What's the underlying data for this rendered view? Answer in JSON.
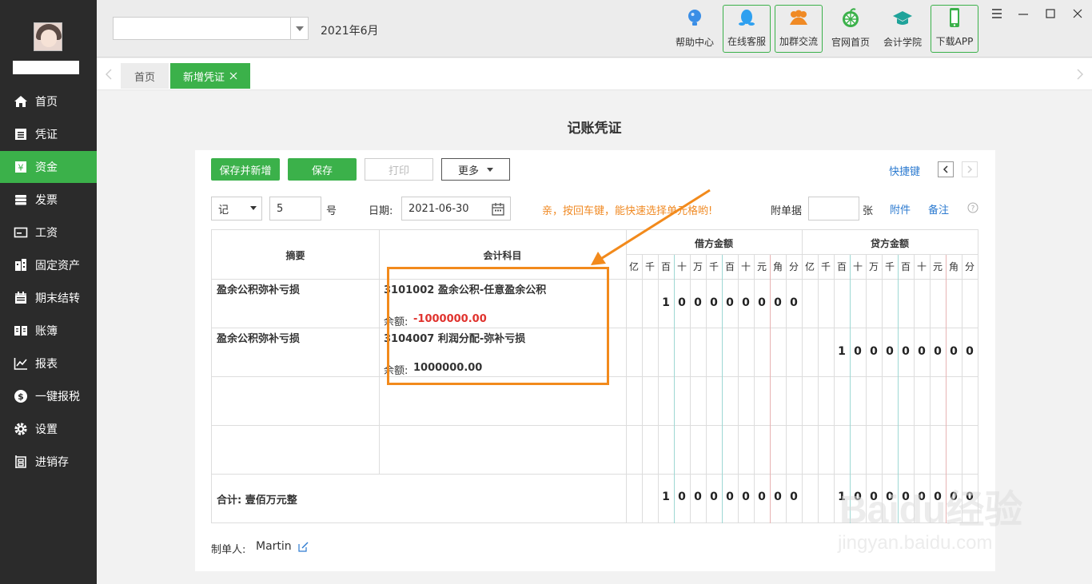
{
  "header": {
    "period": "2021年6月",
    "buttons": [
      {
        "label": "帮助中心"
      },
      {
        "label": "在线客服"
      },
      {
        "label": "加群交流"
      },
      {
        "label": "官网首页"
      },
      {
        "label": "会计学院"
      },
      {
        "label": "下载APP"
      }
    ]
  },
  "sidebar": {
    "items": [
      {
        "label": "首页"
      },
      {
        "label": "凭证"
      },
      {
        "label": "资金"
      },
      {
        "label": "发票"
      },
      {
        "label": "工资"
      },
      {
        "label": "固定资产"
      },
      {
        "label": "期末结转"
      },
      {
        "label": "账簿"
      },
      {
        "label": "报表"
      },
      {
        "label": "一键报税"
      },
      {
        "label": "设置"
      },
      {
        "label": "进销存"
      }
    ],
    "active": "资金"
  },
  "tabs": [
    {
      "label": "首页"
    },
    {
      "label": "新增凭证"
    }
  ],
  "page": {
    "title": "记账凭证",
    "save_new_label": "保存并新增",
    "save_label": "保存",
    "print_label": "打印",
    "more_label": "更多",
    "shortcut_label": "快捷键",
    "voucher_word": "记",
    "voucher_no": "5",
    "no_suffix": "号",
    "date_label": "日期:",
    "date_value": "2021-06-30",
    "tip": "亲，按回车键，能快速选择单元格哟!",
    "attach_label": "附单据",
    "attach_value": "",
    "attach_unit": "张",
    "attachment_link": "附件",
    "remark_link": "备注",
    "maker_label": "制单人:",
    "maker_name": "Martin"
  },
  "table": {
    "headers": {
      "summary": "摘要",
      "account": "会计科目",
      "debit": "借方金额",
      "credit": "贷方金额"
    },
    "digit_headers": [
      "亿",
      "千",
      "百",
      "十",
      "万",
      "千",
      "百",
      "十",
      "元",
      "角",
      "分"
    ],
    "rows": [
      {
        "summary": "盈余公积弥补亏损",
        "account": "3101002 盈余公积-任意盈余公积",
        "balance_label": "余额:",
        "balance": "-1000000.00",
        "debit": "100000000",
        "credit": ""
      },
      {
        "summary": "盈余公积弥补亏损",
        "account": "3104007 利润分配-弥补亏损",
        "balance_label": "余额:",
        "balance": "1000000.00",
        "debit": "",
        "credit": "100000000"
      },
      {
        "summary": "",
        "account": "",
        "balance_label": "",
        "balance": "",
        "debit": "",
        "credit": ""
      },
      {
        "summary": "",
        "account": "",
        "balance_label": "",
        "balance": "",
        "debit": "",
        "credit": ""
      }
    ],
    "total_label": "合计: 壹佰万元整",
    "total_debit": "100000000",
    "total_credit": "100000000"
  },
  "colors": {
    "accent": "#3bb14a",
    "highlight": "#f28a1c",
    "negative": "#e0332e",
    "link": "#2d7bd0"
  },
  "watermark": {
    "brand": "Baidu经验",
    "url": "jingyan.baidu.com"
  }
}
